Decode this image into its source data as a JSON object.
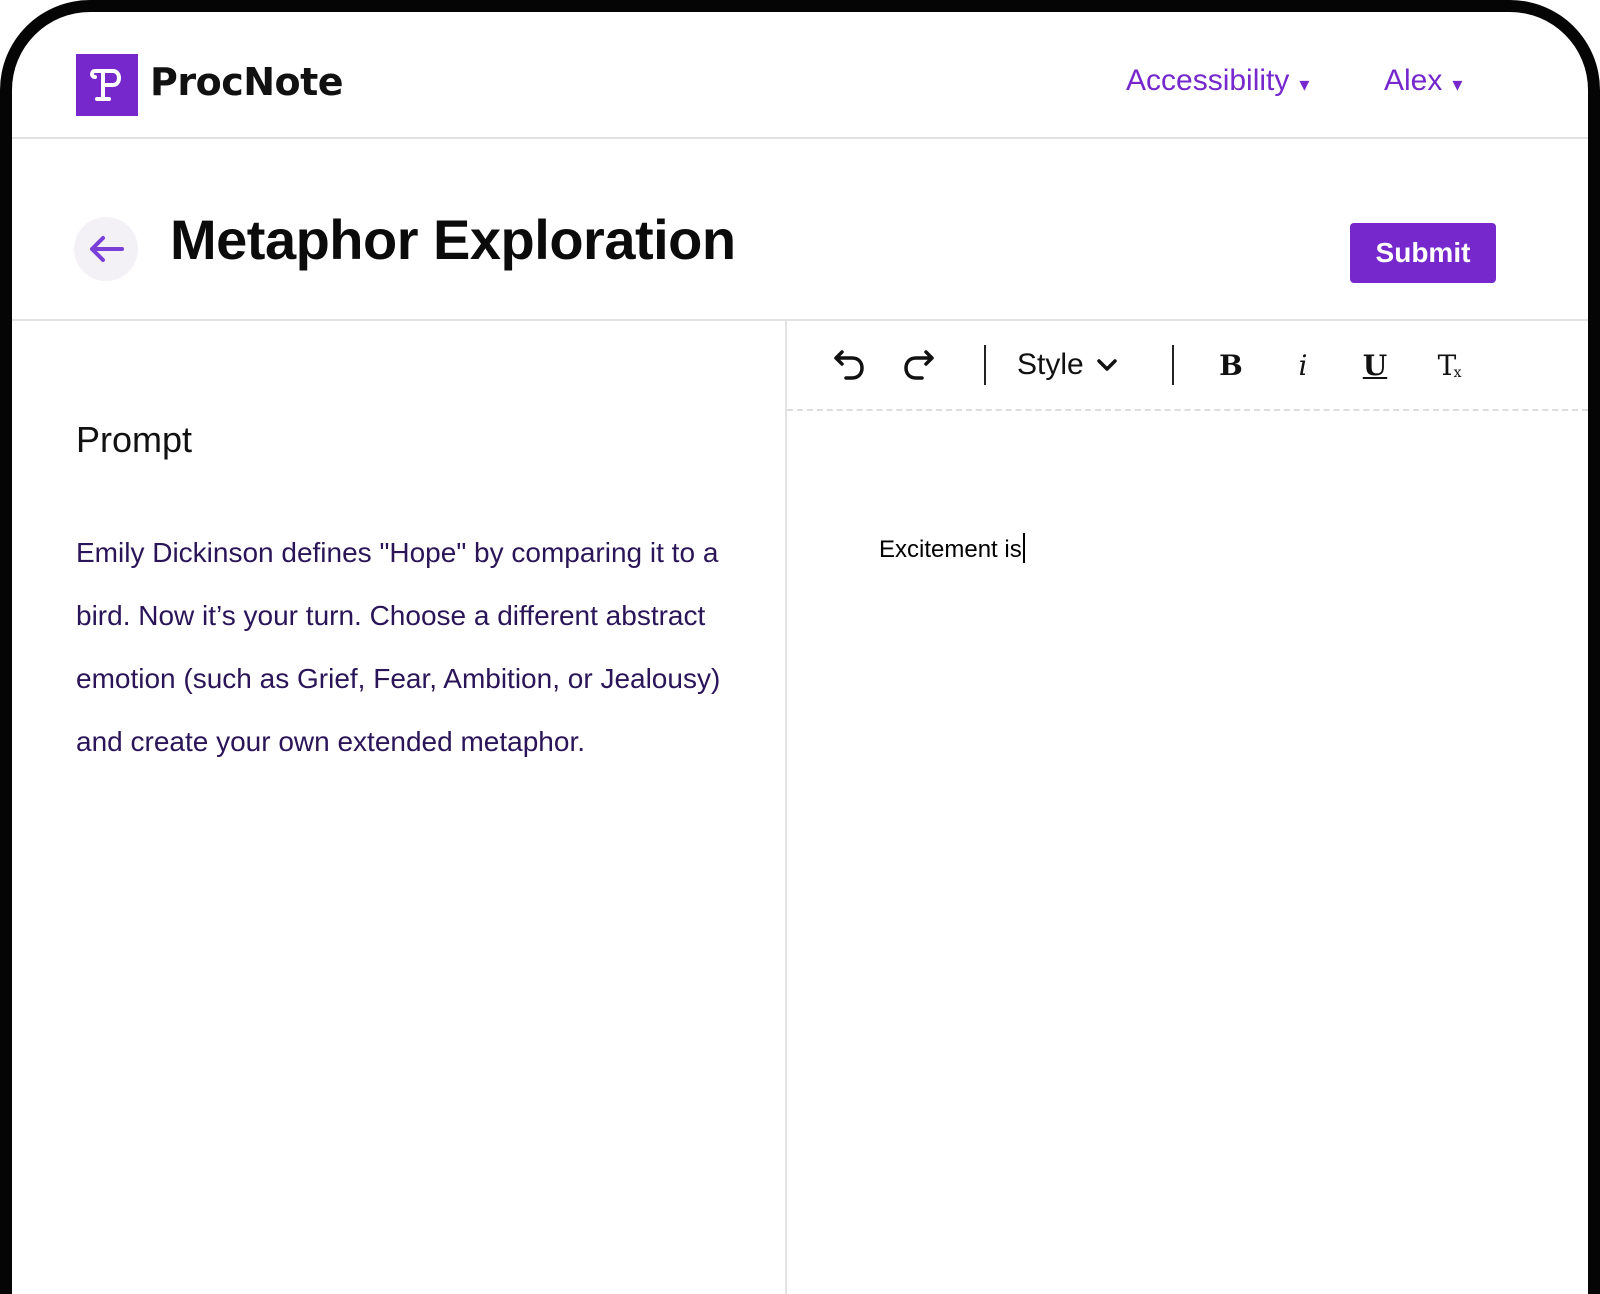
{
  "app": {
    "name": "ProcNote",
    "logo_letter": "P",
    "accent_color": "#7628cc"
  },
  "nav": {
    "accessibility_label": "Accessibility",
    "user_label": "Alex",
    "caret": "▾"
  },
  "page": {
    "title": "Metaphor Exploration",
    "submit_label": "Submit"
  },
  "prompt": {
    "heading": "Prompt",
    "body": "Emily Dickinson defines \"Hope\" by comparing it to a bird. Now it’s your turn. Choose a different abstract emotion (such as Grief, Fear, Ambition, or Jealousy) and create your own extended metaphor."
  },
  "toolbar": {
    "style_label": "Style",
    "icons": [
      "undo-icon",
      "redo-icon",
      "chevron-down-icon",
      "bold-icon",
      "italic-icon",
      "underline-icon",
      "clear-format-icon"
    ]
  },
  "editor": {
    "content": "Excitement is"
  }
}
